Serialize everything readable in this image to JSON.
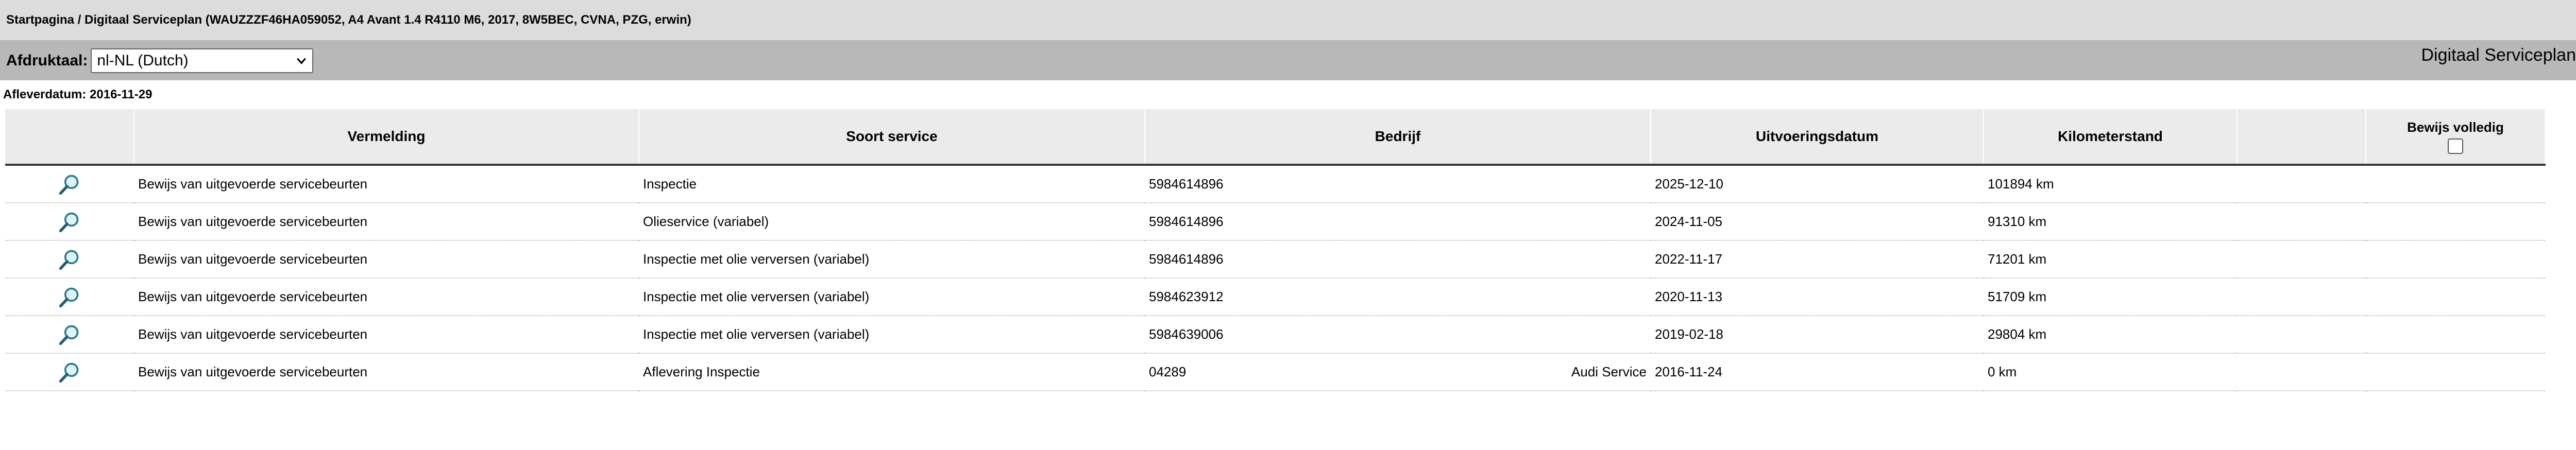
{
  "breadcrumb": "Startpagina / Digitaal Serviceplan (WAUZZZF46HA059052, A4 Avant 1.4 R4110 M6, 2017, 8W5BEC, CVNA, PZG, erwin)",
  "print_language": {
    "label": "Afdruktaal:",
    "value": "nl-NL (Dutch)"
  },
  "page_title": "Digitaal Serviceplan",
  "delivery_date": "Afleverdatum: 2016-11-29",
  "table": {
    "headers": {
      "vermelding": "Vermelding",
      "soort": "Soort service",
      "bedrijf": "Bedrijf",
      "datum": "Uitvoeringsdatum",
      "km": "Kilometerstand",
      "bewijs": "Bewijs volledig"
    },
    "rows": [
      {
        "vermelding": "Bewijs van uitgevoerde servicebeurten",
        "soort": "Inspectie",
        "bedrijf": "5984614896",
        "bedrijf_naam": "",
        "datum": "2025-12-10",
        "km": "101894 km"
      },
      {
        "vermelding": "Bewijs van uitgevoerde servicebeurten",
        "soort": "Olieservice (variabel)",
        "bedrijf": "5984614896",
        "bedrijf_naam": "",
        "datum": "2024-11-05",
        "km": "91310 km"
      },
      {
        "vermelding": "Bewijs van uitgevoerde servicebeurten",
        "soort": "Inspectie met olie verversen (variabel)",
        "bedrijf": "5984614896",
        "bedrijf_naam": "",
        "datum": "2022-11-17",
        "km": "71201 km"
      },
      {
        "vermelding": "Bewijs van uitgevoerde servicebeurten",
        "soort": "Inspectie met olie verversen (variabel)",
        "bedrijf": "5984623912",
        "bedrijf_naam": "",
        "datum": "2020-11-13",
        "km": "51709 km"
      },
      {
        "vermelding": "Bewijs van uitgevoerde servicebeurten",
        "soort": "Inspectie met olie verversen (variabel)",
        "bedrijf": "5984639006",
        "bedrijf_naam": "",
        "datum": "2019-02-18",
        "km": "29804 km"
      },
      {
        "vermelding": "Bewijs van uitgevoerde servicebeurten",
        "soort": "Aflevering Inspectie",
        "bedrijf": "04289",
        "bedrijf_naam": "Audi Service",
        "datum": "2016-11-24",
        "km": "0 km"
      }
    ]
  },
  "icons": {
    "row_details": "magnifier-icon",
    "select": "chevron-down-icon"
  }
}
